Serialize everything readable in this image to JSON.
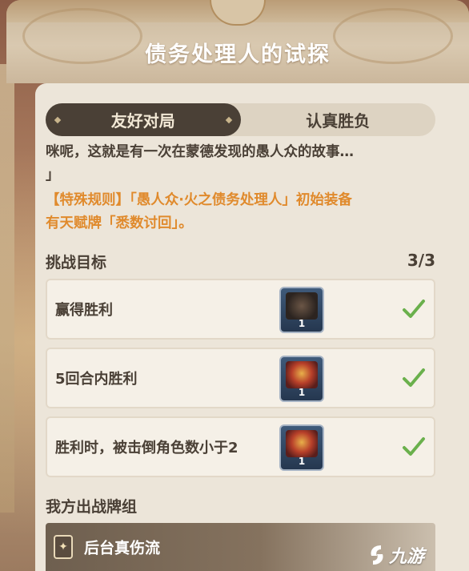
{
  "header": {
    "title": "债务处理人的试探"
  },
  "tabs": [
    {
      "label": "友好对局",
      "active": true
    },
    {
      "label": "认真胜负",
      "active": false
    }
  ],
  "description": {
    "line1": "咪呢，这就是有一次在蒙德发现的愚人众的故事…",
    "line2": "」"
  },
  "special_rule": {
    "line1": "【特殊规则】「愚人众·火之债务处理人」初始装备",
    "line2": "有天赋牌「悉数讨回」。"
  },
  "goals": {
    "heading": "挑战目标",
    "count": "3/3",
    "items": [
      {
        "label": "赢得胜利",
        "reward_count": "1",
        "reward_art": "fatui",
        "completed": true
      },
      {
        "label": "5回合内胜利",
        "reward_count": "1",
        "reward_art": "fire",
        "completed": true
      },
      {
        "label": "胜利时，被击倒角色数小于2",
        "reward_count": "1",
        "reward_art": "fire",
        "completed": true
      }
    ]
  },
  "deck": {
    "heading": "我方出战牌组",
    "name": "后台真伤流"
  },
  "watermark": {
    "text": "九游"
  },
  "colors": {
    "accent_orange": "#e08a2c",
    "text_dark": "#4a4036",
    "check_green": "#6ab04c",
    "tab_active_bg": "#4a4036"
  }
}
